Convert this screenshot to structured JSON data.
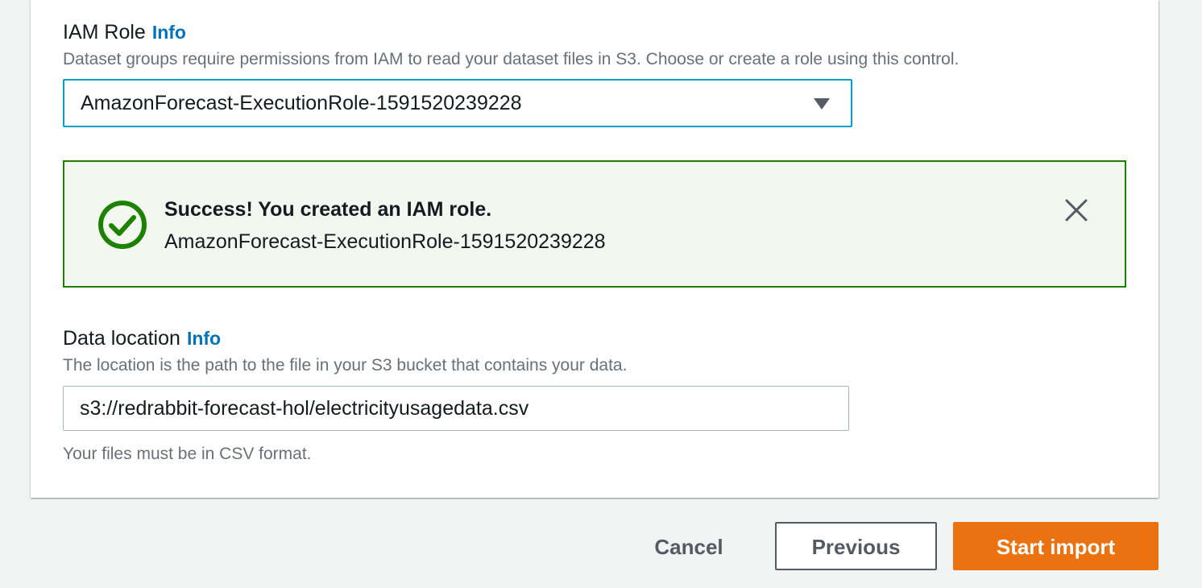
{
  "iam_role": {
    "label": "IAM Role",
    "info": "Info",
    "description": "Dataset groups require permissions from IAM to read your dataset files in S3. Choose or create a role using this control.",
    "selected": "AmazonForecast-ExecutionRole-1591520239228"
  },
  "flash": {
    "title": "Success! You created an IAM role.",
    "message": "AmazonForecast-ExecutionRole-1591520239228",
    "status_color": "#1d8102",
    "icon": "check-circle-icon"
  },
  "data_location": {
    "label": "Data location",
    "info": "Info",
    "description": "The location is the path to the file in your S3 bucket that contains your data.",
    "value": "s3://redrabbit-forecast-hol/electricityusagedata.csv",
    "hint": "Your files must be in CSV format."
  },
  "actions": {
    "cancel": "Cancel",
    "previous": "Previous",
    "start_import": "Start import",
    "primary_color": "#ec7211"
  }
}
